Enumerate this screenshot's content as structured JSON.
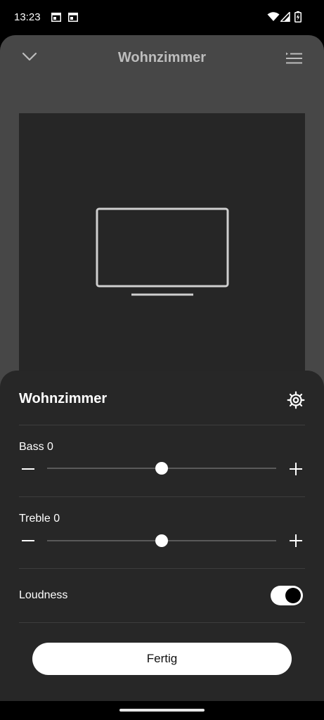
{
  "status_bar": {
    "time": "13:23",
    "icons": [
      "calendar-icon",
      "calendar-icon",
      "wifi-icon",
      "signal-icon",
      "battery-charging-icon"
    ]
  },
  "header": {
    "title": "Wohnzimmer",
    "collapse_icon": "chevron-down-icon",
    "queue_icon": "queue-list-icon"
  },
  "artwork": {
    "icon": "tv-icon"
  },
  "sheet": {
    "title": "Wohnzimmer",
    "settings_icon": "gear-icon",
    "bass": {
      "label": "Bass 0",
      "value": 0,
      "min": -10,
      "max": 10
    },
    "treble": {
      "label": "Treble 0",
      "value": 0,
      "min": -10,
      "max": 10
    },
    "loudness": {
      "label": "Loudness",
      "enabled": true
    },
    "done_label": "Fertig"
  },
  "colors": {
    "panel": "#474747",
    "sheet": "#272727",
    "artwork": "#262626",
    "accent": "#ffffff"
  }
}
